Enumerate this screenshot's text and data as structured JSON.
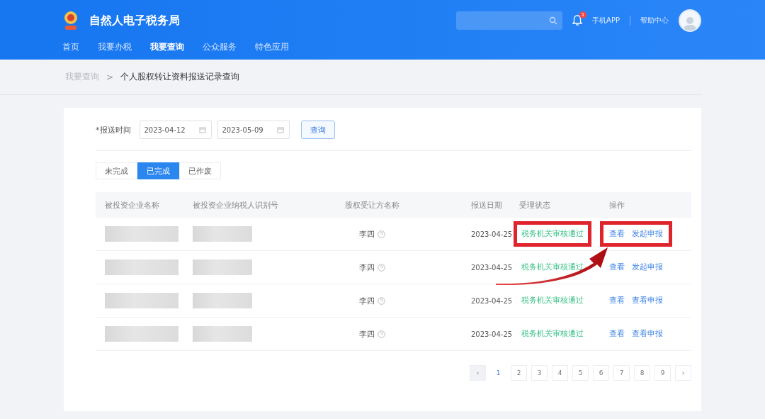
{
  "header": {
    "title": "自然人电子税务局",
    "notification_count": "1",
    "links": [
      "手机APP",
      "帮助中心"
    ]
  },
  "nav": [
    {
      "label": "首页",
      "selected": false
    },
    {
      "label": "我要办税",
      "selected": false
    },
    {
      "label": "我要查询",
      "selected": true
    },
    {
      "label": "公众服务",
      "selected": false
    },
    {
      "label": "特色应用",
      "selected": false
    }
  ],
  "breadcrumb": {
    "parent": "我要查询",
    "separator": ">",
    "current": "个人股权转让资料报送记录查询"
  },
  "filter": {
    "label": "*报送时间",
    "start": "2023-04-12",
    "end": "2023-05-09",
    "button": "查询"
  },
  "tabs": [
    {
      "label": "未完成",
      "selected": false
    },
    {
      "label": "已完成",
      "selected": true
    },
    {
      "label": "已作废",
      "selected": false
    }
  ],
  "table": {
    "columns": [
      "被投资企业名称",
      "被投资企业纳税人识别号",
      "股权受让方名称",
      "报送日期",
      "受理状态",
      "操作"
    ],
    "rows": [
      {
        "transferee": "李四",
        "date": "2023-04-25",
        "status": "税务机关审核通过",
        "actions": [
          "查看",
          "发起申报"
        ],
        "highlighted": true
      },
      {
        "transferee": "李四",
        "date": "2023-04-25",
        "status": "税务机关审核通过",
        "actions": [
          "查看",
          "发起申报"
        ],
        "highlighted": false
      },
      {
        "transferee": "李四",
        "date": "2023-04-25",
        "status": "税务机关审核通过",
        "actions": [
          "查看",
          "查看申报"
        ],
        "highlighted": false
      },
      {
        "transferee": "李四",
        "date": "2023-04-25",
        "status": "税务机关审核通过",
        "actions": [
          "查看",
          "查看申报"
        ],
        "highlighted": false
      }
    ]
  },
  "pagination": {
    "prev": "‹",
    "pages": [
      {
        "label": "1",
        "selected": true
      },
      {
        "label": "2",
        "selected": false
      },
      {
        "label": "3",
        "selected": false
      },
      {
        "label": "4",
        "selected": false
      },
      {
        "label": "5",
        "selected": false
      },
      {
        "label": "6",
        "selected": false
      },
      {
        "label": "7",
        "selected": false
      },
      {
        "label": "8",
        "selected": false
      },
      {
        "label": "9",
        "selected": false
      }
    ],
    "next": "›",
    "prev_disabled": true
  }
}
